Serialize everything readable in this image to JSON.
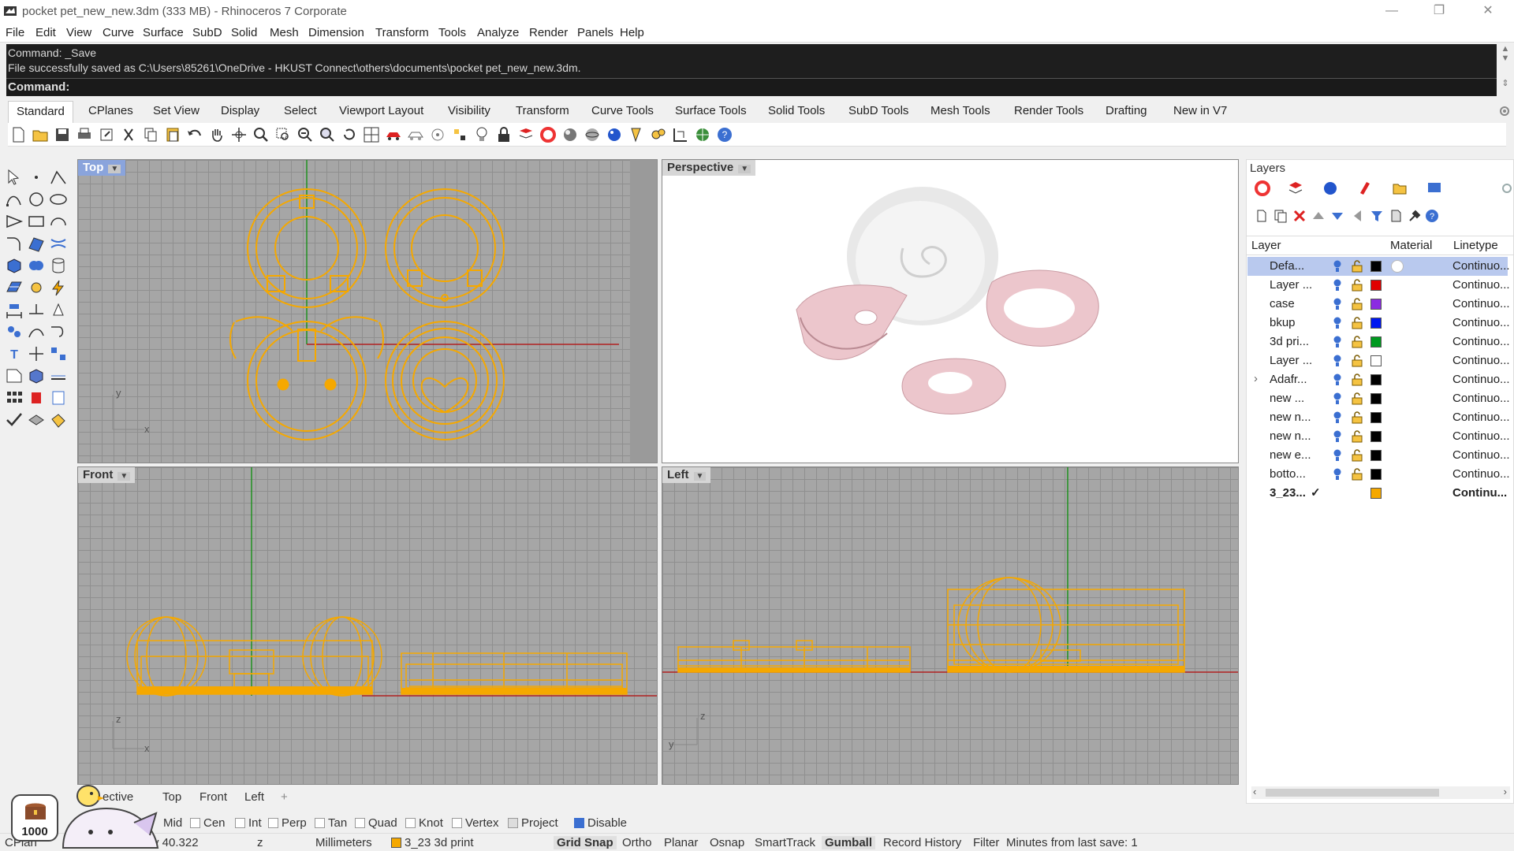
{
  "window": {
    "title": "pocket pet_new_new.3dm (333 MB) - Rhinoceros 7 Corporate",
    "minimize": "—",
    "restore": "❐",
    "close": "✕"
  },
  "menu": [
    "File",
    "Edit",
    "View",
    "Curve",
    "Surface",
    "SubD",
    "Solid",
    "Mesh",
    "Dimension",
    "Transform",
    "Tools",
    "Analyze",
    "Render",
    "Panels",
    "Help"
  ],
  "command": {
    "history": [
      "Command: _Save",
      "File successfully saved as C:\\Users\\85261\\OneDrive - HKUST Connect\\others\\documents\\pocket pet_new_new.3dm."
    ],
    "prompt": "Command:"
  },
  "toolbar_tabs": [
    "Standard",
    "CPlanes",
    "Set View",
    "Display",
    "Select",
    "Viewport Layout",
    "Visibility",
    "Transform",
    "Curve Tools",
    "Surface Tools",
    "Solid Tools",
    "SubD Tools",
    "Mesh Tools",
    "Render Tools",
    "Drafting",
    "New in V7"
  ],
  "viewports": {
    "top": {
      "label": "Top"
    },
    "perspective": {
      "label": "Perspective"
    },
    "front": {
      "label": "Front"
    },
    "left": {
      "label": "Left"
    },
    "axis_x": "x",
    "axis_y": "y",
    "axis_z": "z"
  },
  "viewport_tabs": [
    "ective",
    "Top",
    "Front",
    "Left",
    "+"
  ],
  "osnaps": [
    {
      "label": "Mid",
      "checked": false
    },
    {
      "label": "Cen",
      "checked": false
    },
    {
      "label": "Int",
      "checked": false
    },
    {
      "label": "Perp",
      "checked": false
    },
    {
      "label": "Tan",
      "checked": false
    },
    {
      "label": "Quad",
      "checked": false
    },
    {
      "label": "Knot",
      "checked": false
    },
    {
      "label": "Vertex",
      "checked": false
    },
    {
      "label": "Project",
      "checked": false
    },
    {
      "label": "Disable",
      "checked": true
    }
  ],
  "status": {
    "cplane": "CPlan",
    "y": "y 40.322",
    "z": "z",
    "units": "Millimeters",
    "layer": "3_23 3d print",
    "grid_snap": "Grid Snap",
    "ortho": "Ortho",
    "planar": "Planar",
    "osnap": "Osnap",
    "smarttrack": "SmartTrack",
    "gumball": "Gumball",
    "record_history": "Record History",
    "filter": "Filter",
    "minutes": "Minutes from last save: 1"
  },
  "badge": {
    "count": "1000"
  },
  "layers_panel": {
    "title": "Layers",
    "columns": {
      "layer": "Layer",
      "material": "Material",
      "linetype": "Linetype"
    },
    "rows": [
      {
        "name": "Defa...",
        "color": "#000000",
        "linetype": "Continuo...",
        "selected": true,
        "current": false
      },
      {
        "name": "Layer ...",
        "color": "#e00000",
        "linetype": "Continuo...",
        "selected": false,
        "current": false
      },
      {
        "name": "case",
        "color": "#8b2be2",
        "linetype": "Continuo...",
        "selected": false,
        "current": false
      },
      {
        "name": "bkup",
        "color": "#0018f0",
        "linetype": "Continuo...",
        "selected": false,
        "current": false
      },
      {
        "name": "3d pri...",
        "color": "#009a20",
        "linetype": "Continuo...",
        "selected": false,
        "current": false
      },
      {
        "name": "Layer ...",
        "color": "#ffffff",
        "linetype": "Continuo...",
        "selected": false,
        "current": false
      },
      {
        "name": "Adafr...",
        "color": "#000000",
        "linetype": "Continuo...",
        "selected": false,
        "current": false,
        "expand": "›"
      },
      {
        "name": "new ...",
        "color": "#000000",
        "linetype": "Continuo...",
        "selected": false,
        "current": false
      },
      {
        "name": "new n...",
        "color": "#000000",
        "linetype": "Continuo...",
        "selected": false,
        "current": false
      },
      {
        "name": "new n...",
        "color": "#000000",
        "linetype": "Continuo...",
        "selected": false,
        "current": false
      },
      {
        "name": "new e...",
        "color": "#000000",
        "linetype": "Continuo...",
        "selected": false,
        "current": false
      },
      {
        "name": "botto...",
        "color": "#000000",
        "linetype": "Continuo...",
        "selected": false,
        "current": false
      },
      {
        "name": "3_23...",
        "color": "#f5a800",
        "linetype": "Continu...",
        "selected": false,
        "current": true,
        "check": "✓"
      }
    ]
  },
  "colors": {
    "wire": "#f5a800",
    "grid_bg": "#a6a6a6",
    "x_axis": "#b02020",
    "y_axis": "#209020",
    "part_pink": "#ecc6cc"
  }
}
